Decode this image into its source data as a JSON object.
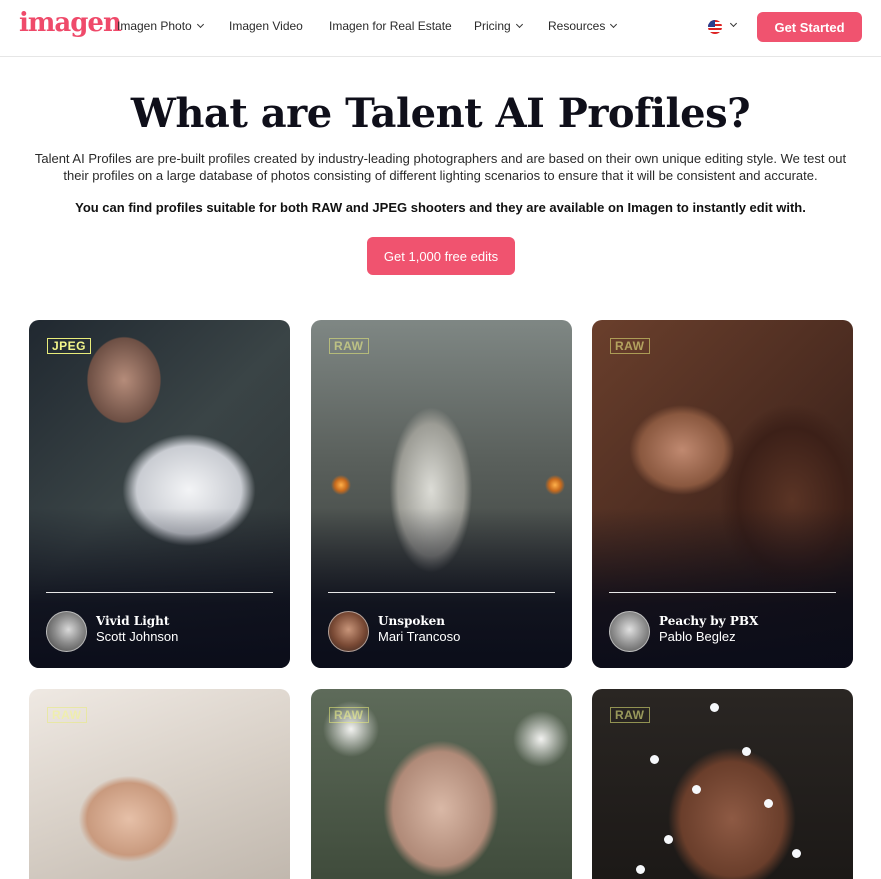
{
  "nav": {
    "logo": "imagen",
    "items": [
      {
        "label": "Imagen Photo",
        "dropdown": true
      },
      {
        "label": "Imagen Video",
        "dropdown": false
      },
      {
        "label": "Imagen for Real Estate",
        "dropdown": false
      },
      {
        "label": "Pricing",
        "dropdown": true
      },
      {
        "label": "Resources",
        "dropdown": true
      }
    ],
    "language_icon": "us-flag-icon",
    "cta_label": "Get Started"
  },
  "hero": {
    "title": "What are Talent AI Profiles?",
    "description": "Talent AI Profiles are pre-built profiles created by industry-leading photographers and are based on their own unique editing style. We test out their profiles on a large database of photos consisting of different lighting scenarios to ensure that it will be consistent and accurate.",
    "emphasis": "You can find profiles suitable for both RAW and JPEG shooters and they are available on Imagen to instantly edit with.",
    "cta_label": "Get 1,000 free edits"
  },
  "profiles": [
    {
      "badge": "JPEG",
      "name": "Vivid Light",
      "author": "Scott Johnson"
    },
    {
      "badge": "RAW",
      "name": "Unspoken",
      "author": "Mari Trancoso"
    },
    {
      "badge": "RAW",
      "name": "Peachy by PBX",
      "author": "Pablo Beglez"
    },
    {
      "badge": "RAW"
    },
    {
      "badge": "RAW"
    },
    {
      "badge": "RAW"
    }
  ],
  "colors": {
    "brand": "#f0536f",
    "badge": "#f4f78b",
    "title": "#0f0f1a"
  }
}
